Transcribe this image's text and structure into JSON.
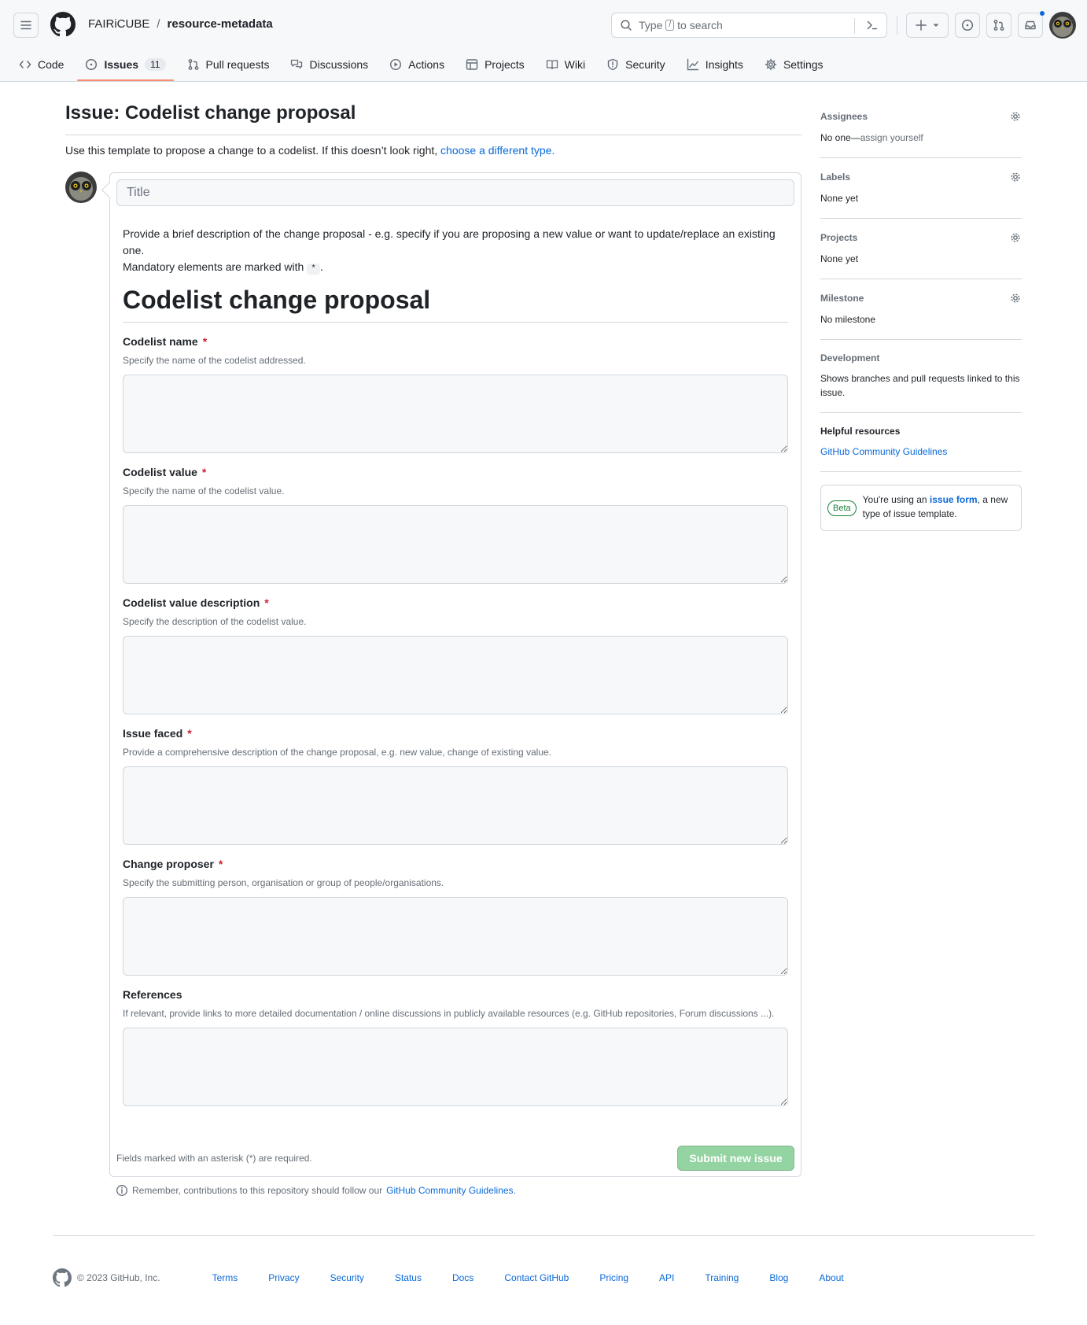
{
  "header": {
    "owner": "FAIRiCUBE",
    "separator": "/",
    "repo": "resource-metadata",
    "search_prefix": "Type",
    "search_key": "/",
    "search_suffix": "to search"
  },
  "nav": {
    "code": "Code",
    "issues": "Issues",
    "issues_count": "11",
    "pull_requests": "Pull requests",
    "discussions": "Discussions",
    "actions": "Actions",
    "projects": "Projects",
    "wiki": "Wiki",
    "security": "Security",
    "insights": "Insights",
    "settings": "Settings"
  },
  "page": {
    "title": "Issue: Codelist change proposal",
    "template_note": "Use this template to propose a change to a codelist. If this doesn’t look right,",
    "template_link": "choose a different type."
  },
  "form": {
    "title_placeholder": "Title",
    "intro_line1": "Provide a brief description of the change proposal - e.g. specify if you are proposing a new value or want to update/replace an existing one.",
    "intro_line2_prefix": "Mandatory elements are marked with",
    "intro_code": "*",
    "intro_line2_suffix": ".",
    "heading": "Codelist change proposal",
    "required_mark": "*",
    "fields": [
      {
        "label": "Codelist name",
        "description": "Specify the name of the codelist addressed."
      },
      {
        "label": "Codelist value",
        "description": "Specify the name of the codelist value."
      },
      {
        "label": "Codelist value description",
        "description": "Specify the description of the codelist value."
      },
      {
        "label": "Issue faced",
        "description": "Provide a comprehensive description of the change proposal, e.g. new value, change of existing value."
      },
      {
        "label": "Change proposer",
        "description": "Specify the submitting person, organisation or group of people/organisations."
      },
      {
        "label": "References",
        "description": "If relevant, provide links to more detailed documentation / online discussions in publicly available resources (e.g. GitHub repositories, Forum discussions ...)."
      }
    ],
    "footer_note": "Fields marked with an asterisk (*) are required.",
    "submit": "Submit new issue"
  },
  "remember": {
    "text": "Remember, contributions to this repository should follow our",
    "link": "GitHub Community Guidelines",
    "suffix": "."
  },
  "sidebar": {
    "assignees_title": "Assignees",
    "assignees_value": "No one—",
    "assignees_link": "assign yourself",
    "labels_title": "Labels",
    "labels_value": "None yet",
    "projects_title": "Projects",
    "projects_value": "None yet",
    "milestone_title": "Milestone",
    "milestone_value": "No milestone",
    "development_title": "Development",
    "development_value": "Shows branches and pull requests linked to this issue.",
    "helpful_title": "Helpful resources",
    "helpful_link": "GitHub Community Guidelines",
    "beta_badge": "Beta",
    "beta_prefix": "You're using an",
    "beta_link": "issue form",
    "beta_suffix": ", a new type of issue template."
  },
  "footer": {
    "copyright": "© 2023 GitHub, Inc.",
    "links": [
      "Terms",
      "Privacy",
      "Security",
      "Status",
      "Docs",
      "Contact GitHub",
      "Pricing",
      "API",
      "Training",
      "Blog",
      "About"
    ]
  },
  "colors": {
    "accent": "#0969da",
    "selected_tab": "#fd8c73",
    "required": "#cf222e",
    "submit_disabled": "#94d3a2"
  }
}
